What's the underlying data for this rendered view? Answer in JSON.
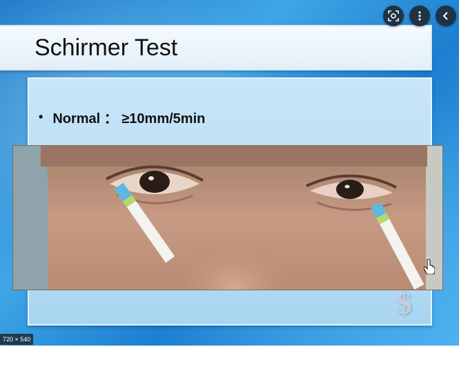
{
  "slide": {
    "title": "Schirmer Test",
    "bullet": "Normal ： ≥10mm/5min"
  },
  "image_size_badge": "720 × 540",
  "toolbar": {
    "lens_icon": "lens-icon",
    "more_icon": "more-vert-icon",
    "back_icon": "chevron-left-icon"
  }
}
